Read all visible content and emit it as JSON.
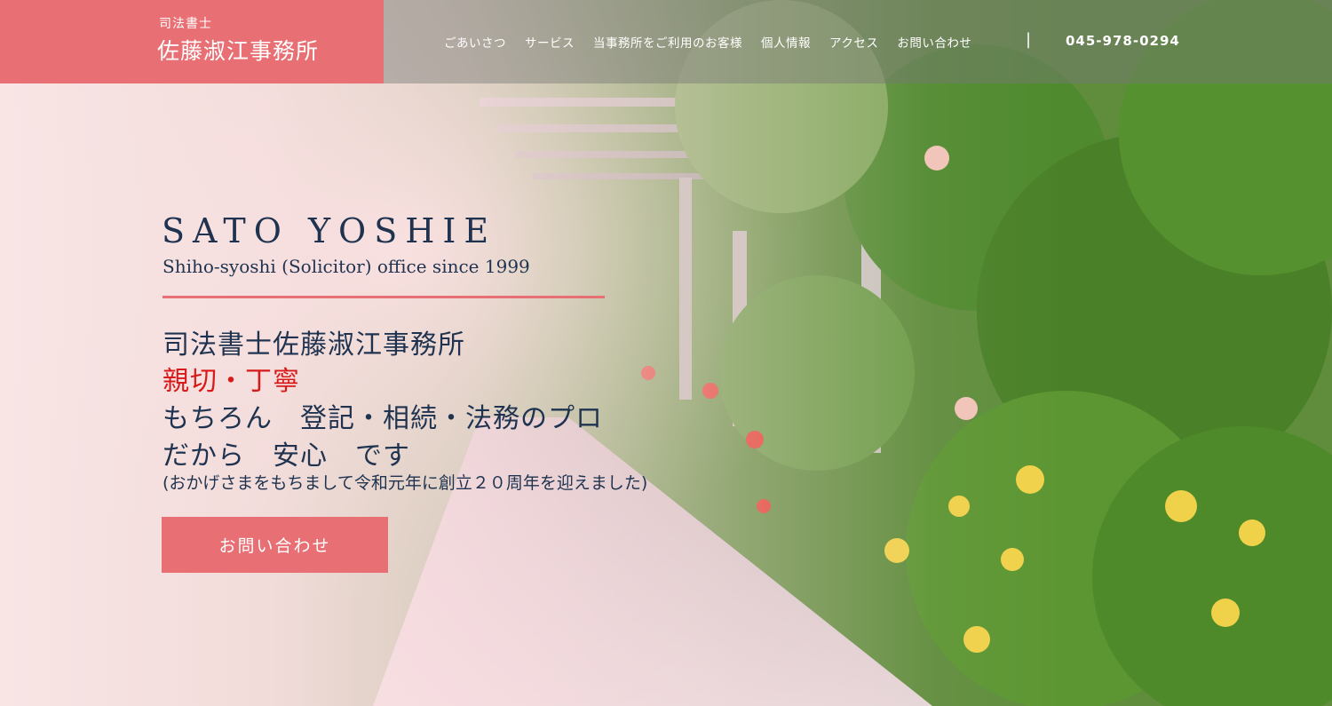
{
  "brand": {
    "sub": "司法書士",
    "name": "佐藤淑江事務所"
  },
  "nav": {
    "items": [
      "ごあいさつ",
      "サービス",
      "当事務所をご利用のお客様",
      "個人情報",
      "アクセス",
      "お問い合わせ"
    ],
    "separator": "|",
    "phone": "045-978-0294"
  },
  "hero": {
    "title_en": "SATO YOSHIE",
    "subtitle_en": "Shiho-syoshi (Solicitor) office since 1999",
    "line1": "司法書士佐藤淑江事務所",
    "line2": "親切・丁寧",
    "line3": "もちろん　登記・相続・法務のプロ",
    "line4": "だから　安心　です",
    "note": "(おかげさまをもちまして令和元年に創立２０周年を迎えました)",
    "cta": "お問い合わせ"
  },
  "colors": {
    "accent": "#e86f73",
    "text": "#1f3350",
    "highlight": "#d81a1a"
  }
}
